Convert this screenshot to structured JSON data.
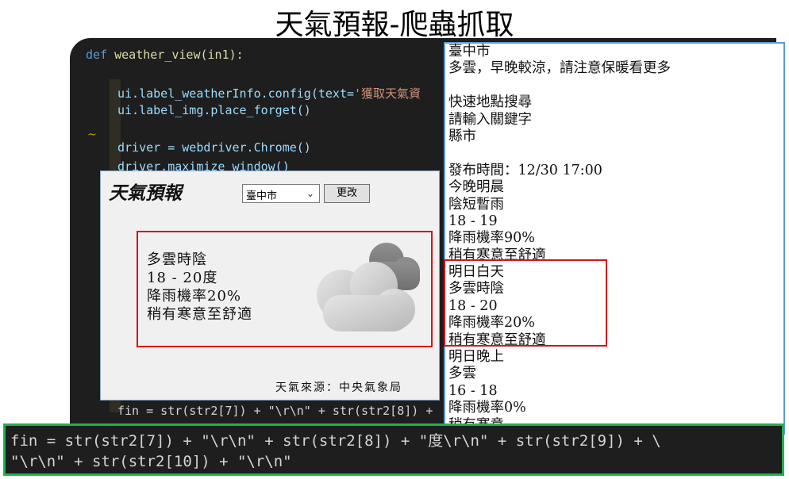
{
  "page_title": "天氣預報-爬蟲抓取",
  "editor": {
    "line_def": "def weather_view(in1):",
    "line_def_kw": "def",
    "line_def_rest": " weather_view(in1):",
    "line_label_a": "ui.label_weatherInfo.config(text=",
    "line_label_b": "'獲取天氣資",
    "line_img": "ui.label_img.place_forget()",
    "line_driver": "driver = webdriver.Chrome()",
    "line_max": "driver.maximize_window()",
    "line_fin": "fin = str(str2[7]) + \"\\r\\n\" + str(str2[8]) +",
    "squiggle": "~"
  },
  "webpage": {
    "lines": [
      "臺中市",
      "多雲，早晚較涼，請注意保暖看更多",
      "",
      "快速地點搜尋",
      "請輸入關鍵字",
      "縣市",
      "",
      "發布時間：12/30 17:00",
      "今晚明晨",
      "陰短暫雨",
      "18 - 19",
      "降雨機率90%",
      "稍有寒意至舒適",
      "明日白天",
      "多雲時陰",
      "18 - 20",
      "降雨機率20%",
      "稍有寒意至舒適",
      "明日晚上",
      "多雲",
      "16 - 18",
      "降雨機率0%",
      "稍有寒意"
    ]
  },
  "app": {
    "title": "天氣預報",
    "city_select": "臺中市",
    "change_button": "更改",
    "info_lines": "多雲時陰\n18 - 20度\n降雨機率20%\n稍有寒意至舒適",
    "source": "天氣來源：中央氣象局",
    "weather_icon": "cloudy-icon"
  },
  "bottom_code": {
    "line1": "fin = str(str2[7]) + \"\\r\\n\" + str(str2[8]) + \"度\\r\\n\" + str(str2[9]) + \\",
    "line2": "\"\\r\\n\" + str(str2[10]) + \"\\r\\n\""
  },
  "colors": {
    "highlight_red": "#d0161b",
    "highlight_green": "#22b14c",
    "browser_border": "#5b9bd5"
  }
}
